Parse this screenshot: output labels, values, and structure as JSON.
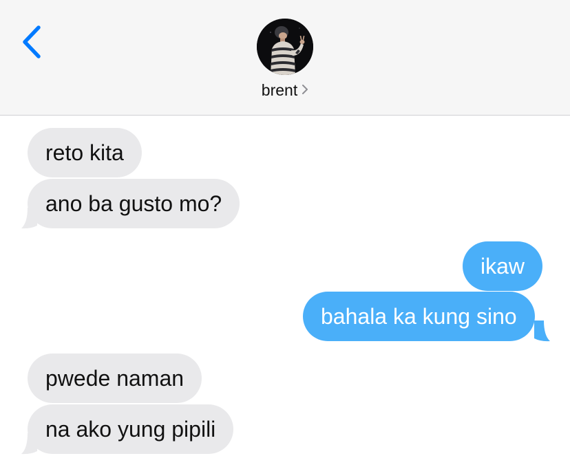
{
  "header": {
    "contact_name": "brent",
    "back_icon": "chevron-left-icon",
    "name_chevron_icon": "chevron-right-icon",
    "accent_color": "#007aff"
  },
  "messages": [
    {
      "direction": "incoming",
      "text": "reto kita"
    },
    {
      "direction": "incoming",
      "text": "ano ba gusto mo?"
    },
    {
      "direction": "outgoing",
      "text": "ikaw"
    },
    {
      "direction": "outgoing",
      "text": "bahala ka kung sino"
    },
    {
      "direction": "incoming",
      "text": "pwede naman"
    },
    {
      "direction": "incoming",
      "text": "na ako yung pipili"
    }
  ],
  "colors": {
    "incoming_bubble": "#e9e9eb",
    "outgoing_bubble": "#4aaff9",
    "header_bg": "#f6f6f6"
  }
}
